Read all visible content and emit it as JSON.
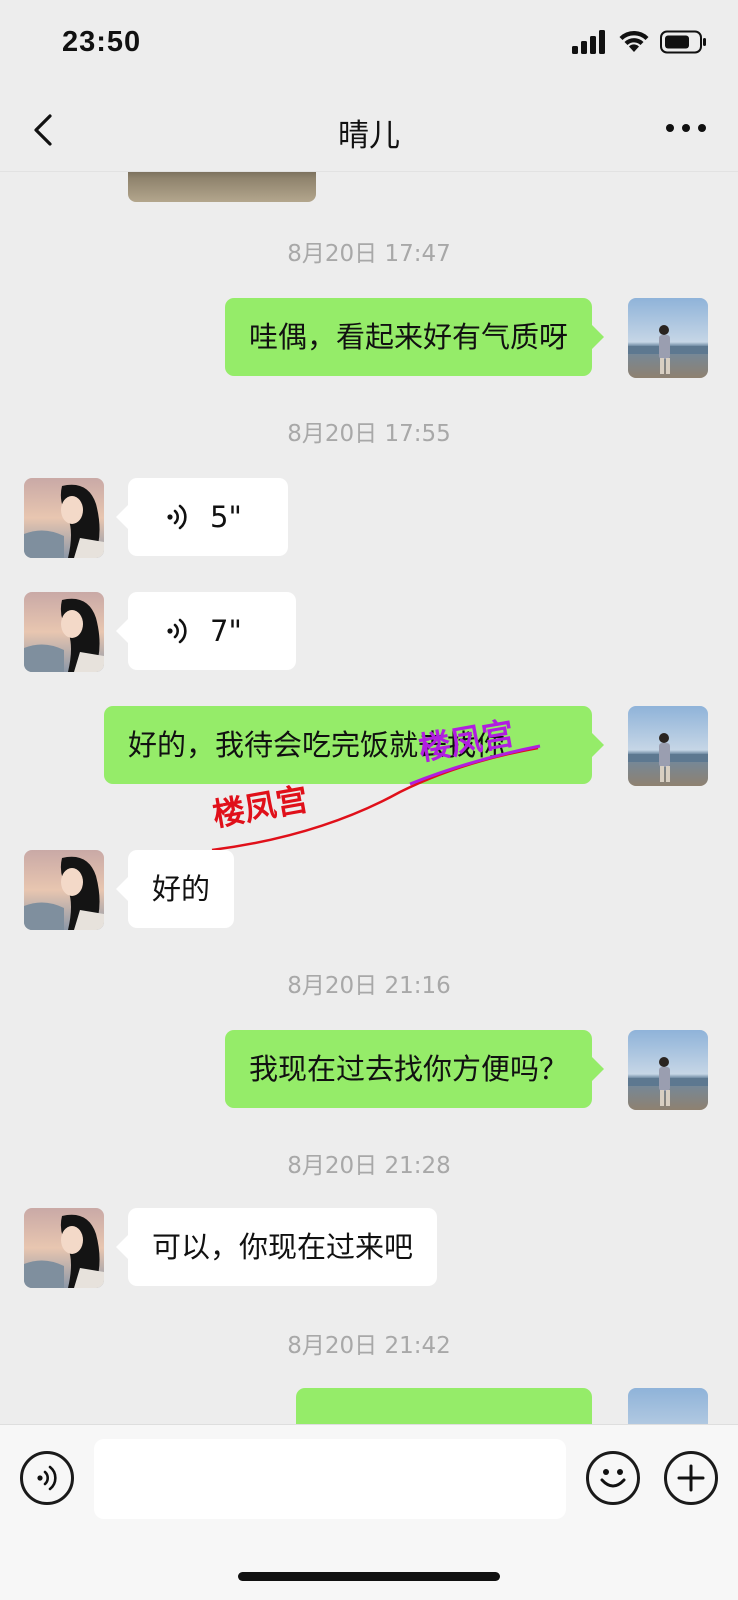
{
  "status_bar": {
    "time": "23:50"
  },
  "header": {
    "title": "晴儿"
  },
  "messages": [
    {
      "type": "timestamp",
      "text": "8月20日 17:47"
    },
    {
      "type": "text",
      "side": "right",
      "text": "哇偶，看起来好有气质呀"
    },
    {
      "type": "timestamp",
      "text": "8月20日 17:55"
    },
    {
      "type": "voice",
      "side": "left",
      "duration": "5\""
    },
    {
      "type": "voice",
      "side": "left",
      "duration": "7\""
    },
    {
      "type": "text",
      "side": "right",
      "text": "好的，我待会吃完饭就去找你"
    },
    {
      "type": "text",
      "side": "left",
      "text": "好的"
    },
    {
      "type": "timestamp",
      "text": "8月20日 21:16"
    },
    {
      "type": "text",
      "side": "right",
      "text": "我现在过去找你方便吗？"
    },
    {
      "type": "timestamp",
      "text": "8月20日 21:28"
    },
    {
      "type": "text",
      "side": "left",
      "text": "可以，你现在过来吧"
    },
    {
      "type": "timestamp",
      "text": "8月20日 21:42"
    }
  ],
  "watermarks": [
    "楼凤宫",
    "楼凤宫"
  ],
  "input": {
    "value": "",
    "placeholder": ""
  },
  "icons": {
    "back": "chevron-left-icon",
    "more": "more-dots-icon",
    "voice_toggle": "voice-icon",
    "emoji": "emoji-icon",
    "add": "plus-icon"
  },
  "colors": {
    "background": "#ededed",
    "sent_bubble": "#95ec69",
    "received_bubble": "#ffffff",
    "timestamp": "#a8a8a8"
  }
}
